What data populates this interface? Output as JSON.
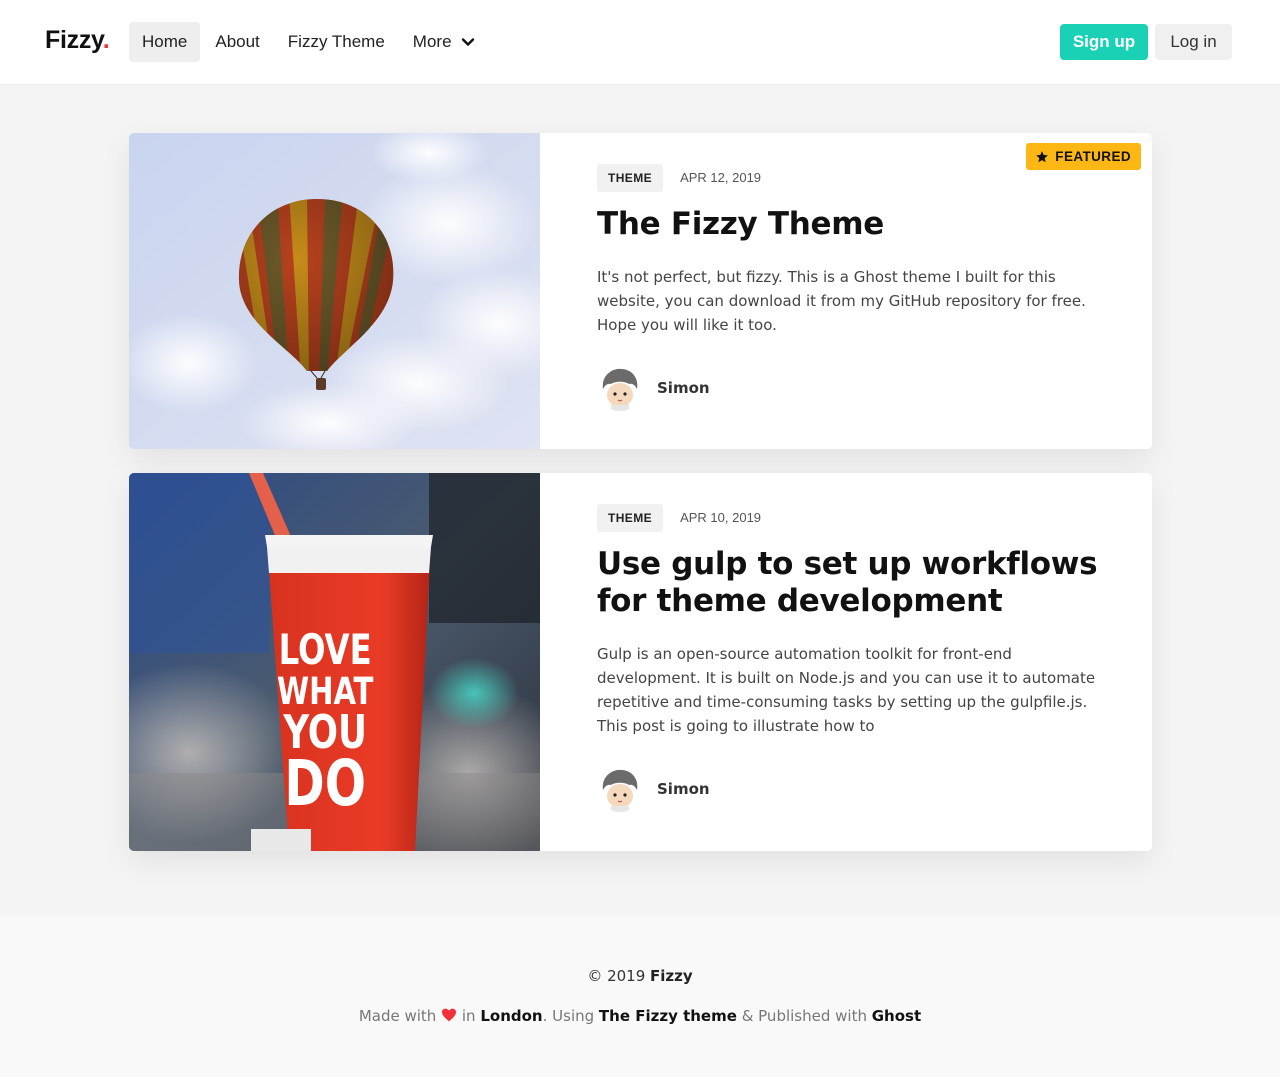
{
  "header": {
    "logo": "Fizzy",
    "logo_dot": ".",
    "nav": [
      {
        "label": "Home",
        "active": true
      },
      {
        "label": "About"
      },
      {
        "label": "Fizzy Theme"
      },
      {
        "label": "More",
        "icon": "chevron-down-icon"
      }
    ],
    "signup_label": "Sign up",
    "login_label": "Log in"
  },
  "posts": [
    {
      "tag": "THEME",
      "date": "APR 12, 2019",
      "title": "The Fizzy Theme",
      "excerpt": "It's not perfect, but fizzy. This is a Ghost theme I built for this website, you can download it from my GitHub repository for free. Hope you will like it too.",
      "author": "Simon",
      "featured": true,
      "featured_label": "FEATURED",
      "image": "hot-air-balloon"
    },
    {
      "tag": "THEME",
      "date": "APR 10, 2019",
      "title": "Use gulp to set up workflows for theme development",
      "excerpt": "Gulp is an open-source automation toolkit for front-end development. It is built on Node.js and you can use it to automate repetitive and time-consuming tasks by setting up the gulpfile.js. This post is going to illustrate how to",
      "author": "Simon",
      "image": "red-cup-love-what-you-do",
      "image_text": [
        "LOVE",
        "WHAT",
        "YOU",
        "DO"
      ]
    }
  ],
  "footer": {
    "copyright_prefix": "© 2019",
    "copyright_brand": "Fizzy",
    "made_with": "Made with",
    "in": "in",
    "city": "London",
    "using": ". Using",
    "theme_link": "The Fizzy theme",
    "published": "& Published with",
    "ghost_link": "Ghost"
  },
  "colors": {
    "accent": "#1ad0b5",
    "featured": "#fcb715",
    "logo_dot": "#f2313a",
    "heart": "#f2313a"
  }
}
